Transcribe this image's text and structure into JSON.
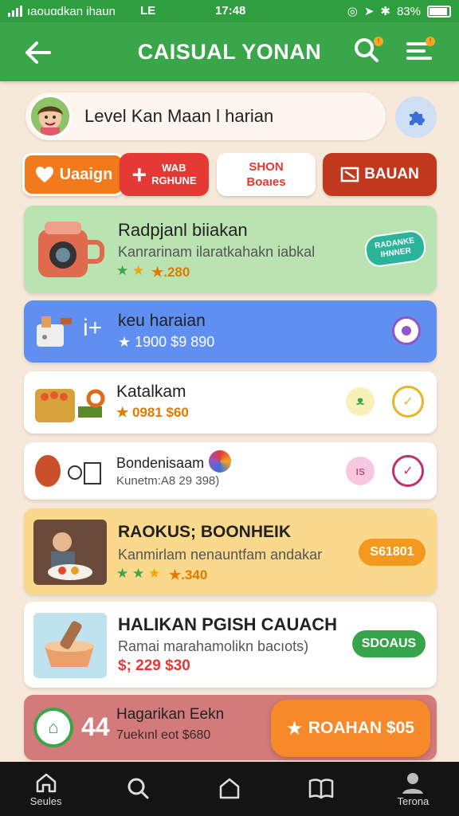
{
  "status_bar": {
    "carrier": "ıaouɑdkan ihaun",
    "network": "LE",
    "time": "17:48",
    "battery": "83%"
  },
  "app_bar": {
    "title": "CAISUAL YONAN"
  },
  "level_bar": {
    "text": "Level Kan Maan l harian"
  },
  "actions": [
    {
      "label": "Uaaign"
    },
    {
      "label_line1": "WAB",
      "label_line2": "RGHUNE"
    },
    {
      "label_line1": "SHON",
      "label_line2": "Boaıes"
    },
    {
      "label": "BAUAN"
    }
  ],
  "cards": [
    {
      "title": "Radpjanl biiakan",
      "subtitle": "Kanrarinam ilaratkahakn iabkal",
      "price": "★.280",
      "badge_line1": "RADANKE",
      "badge_line2": "IHNNER"
    },
    {
      "title": "keu haraian",
      "price": "★ 1900 $9 890"
    },
    {
      "title": "Katalkam",
      "price": "★ 0981 $60"
    },
    {
      "title": "Bondenisaam",
      "subtitle": "Kunetm:A8 29 398)",
      "pill_text": "ıs"
    },
    {
      "title": "RAOKUS; BOONHEIK",
      "subtitle": "Kanmirlam nenauntfam andakar",
      "price": "★.340",
      "badge": "S61801"
    },
    {
      "title": "HALIKAN PGISH CAUACH",
      "subtitle": "Ramai marahamolikn bacıots)",
      "price": "$; 229 $30",
      "badge": "SDOAUS"
    },
    {
      "title": "Hagarikan Eekn",
      "subtitle": "7uekınl eot $680",
      "side": "44",
      "cta": "ROAHAN $05"
    }
  ],
  "nav": [
    {
      "label": "Seules",
      "icon": "home-icon"
    },
    {
      "label": "",
      "icon": "search-icon"
    },
    {
      "label": "",
      "icon": "house-icon"
    },
    {
      "label": "",
      "icon": "book-icon"
    },
    {
      "label": "Terona",
      "icon": "profile-icon"
    }
  ],
  "colors": {
    "green": "#3aa64a",
    "orange": "#f27a1a",
    "red": "#e53935",
    "brown_red": "#c0391e",
    "blue": "#5f8ff0"
  }
}
